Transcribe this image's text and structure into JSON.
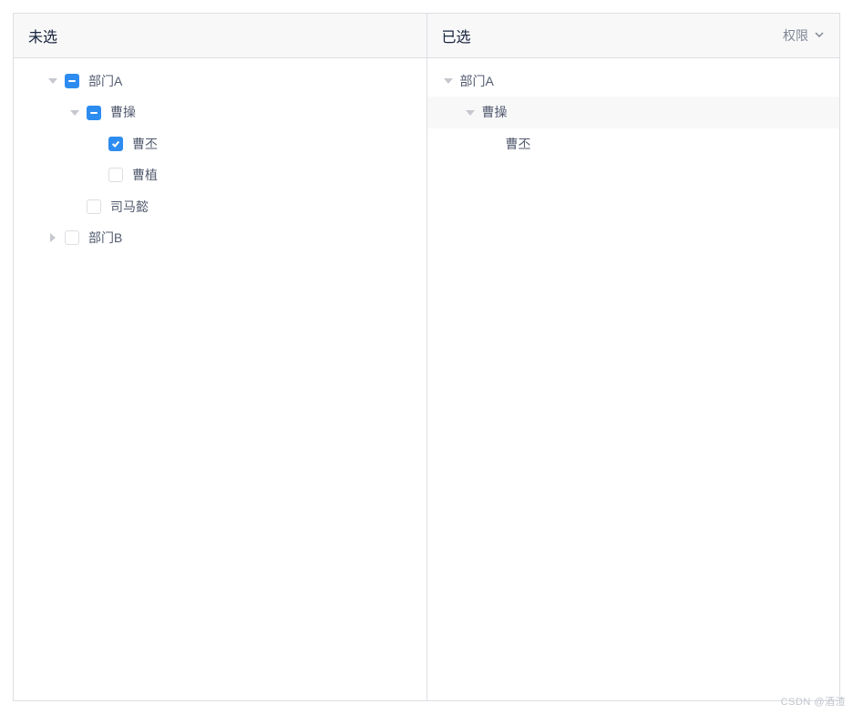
{
  "leftPanel": {
    "title": "未选",
    "tree": {
      "deptA": {
        "label": "部门A",
        "expanded": true,
        "checkState": "indeterminate",
        "children": {
          "caoCao": {
            "label": "曹操",
            "expanded": true,
            "checkState": "indeterminate",
            "children": {
              "caoPi": {
                "label": "曹丕",
                "checkState": "checked"
              },
              "caoZhi": {
                "label": "曹植",
                "checkState": "unchecked"
              }
            }
          },
          "simaYi": {
            "label": "司马懿",
            "checkState": "unchecked"
          }
        }
      },
      "deptB": {
        "label": "部门B",
        "expanded": false,
        "checkState": "unchecked"
      }
    }
  },
  "rightPanel": {
    "title": "已选",
    "action": {
      "label": "权限"
    },
    "tree": {
      "deptA": {
        "label": "部门A",
        "expanded": true,
        "children": {
          "caoCao": {
            "label": "曹操",
            "expanded": true,
            "highlighted": true,
            "children": {
              "caoPi": {
                "label": "曹丕"
              }
            }
          }
        }
      }
    }
  },
  "watermark": "CSDN @酒渣"
}
